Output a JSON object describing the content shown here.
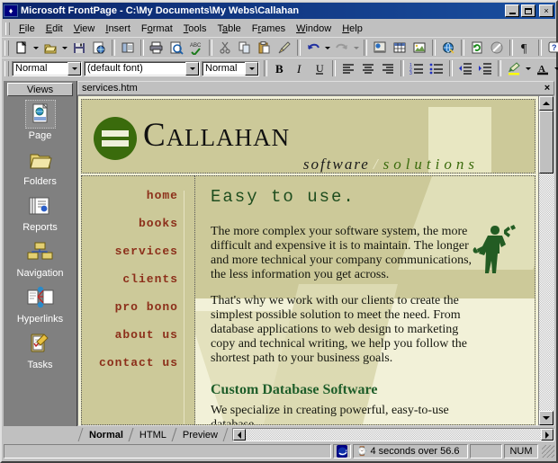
{
  "window": {
    "title": "Microsoft FrontPage - C:\\My Documents\\My Webs\\Callahan",
    "icon": "frontpage-icon",
    "minimize_label": "_",
    "maximize_label": "",
    "close_label": "×"
  },
  "menubar": {
    "items": [
      {
        "label": "File",
        "accel": "F"
      },
      {
        "label": "Edit",
        "accel": "E"
      },
      {
        "label": "View",
        "accel": "V"
      },
      {
        "label": "Insert",
        "accel": "I"
      },
      {
        "label": "Format",
        "accel": "o"
      },
      {
        "label": "Tools",
        "accel": "T"
      },
      {
        "label": "Table",
        "accel": "a"
      },
      {
        "label": "Frames",
        "accel": "r"
      },
      {
        "label": "Window",
        "accel": "W"
      },
      {
        "label": "Help",
        "accel": "H"
      }
    ]
  },
  "standard_toolbar": {
    "buttons": [
      "new-page-icon",
      "new-page-dropdown-icon",
      "open-icon",
      "open-dropdown-icon",
      "save-icon",
      "publish-web-icon",
      "folder-list-icon",
      "print-icon",
      "print-preview-icon",
      "spelling-icon",
      "cut-icon",
      "copy-icon",
      "paste-icon",
      "format-painter-icon",
      "undo-icon",
      "undo-dropdown-icon",
      "redo-icon",
      "redo-dropdown-icon",
      "insert-component-icon",
      "insert-table-icon",
      "insert-picture-icon",
      "hyperlink-icon",
      "refresh-icon",
      "stop-icon",
      "show-all-icon",
      "help-icon",
      "help-dropdown-icon"
    ]
  },
  "formatting_toolbar": {
    "style_combo": {
      "value": "Normal",
      "name": "style-combo"
    },
    "font_combo": {
      "value": "(default font)",
      "name": "font-combo"
    },
    "size_combo": {
      "value": "Normal",
      "name": "font-size-combo"
    },
    "buttons": [
      "bold-icon",
      "italic-icon",
      "underline-icon",
      "align-left-icon",
      "align-center-icon",
      "align-right-icon",
      "numbered-list-icon",
      "bulleted-list-icon",
      "decrease-indent-icon",
      "increase-indent-icon",
      "highlight-color-icon",
      "highlight-dropdown-icon",
      "font-color-icon",
      "font-color-dropdown-icon",
      "toolbar-overflow-icon"
    ]
  },
  "views_bar": {
    "header": "Views",
    "items": [
      {
        "label": "Page",
        "icon": "page-view-icon",
        "selected": true
      },
      {
        "label": "Folders",
        "icon": "folders-view-icon",
        "selected": false
      },
      {
        "label": "Reports",
        "icon": "reports-view-icon",
        "selected": false
      },
      {
        "label": "Navigation",
        "icon": "navigation-view-icon",
        "selected": false
      },
      {
        "label": "Hyperlinks",
        "icon": "hyperlinks-view-icon",
        "selected": false
      },
      {
        "label": "Tasks",
        "icon": "tasks-view-icon",
        "selected": false
      }
    ]
  },
  "document": {
    "tab_label": "services.htm",
    "close_label": "×"
  },
  "webpage": {
    "logo": {
      "mark": "equals-circle-logo",
      "brand_first": "C",
      "brand_rest": "ALLAHAN",
      "tagline_primary": "software",
      "tagline_separator": "/",
      "tagline_secondary": "solutions"
    },
    "nav_links": [
      {
        "label": "home"
      },
      {
        "label": "books"
      },
      {
        "label": "services"
      },
      {
        "label": "clients"
      },
      {
        "label": "pro bono"
      },
      {
        "label": "about us"
      },
      {
        "label": "contact us"
      }
    ],
    "heading": "Easy to use.",
    "paragraphs": [
      "The more complex your software system, the more difficult and expensive it is to maintain. The longer and more technical your company communications, the less information you get across.",
      "That's why we work with our clients to create the simplest possible solution to meet the need. From database applications to web design to marketing copy and technical writing, we help you follow the shortest path to your business goals."
    ],
    "subheading": "Custom Database Software",
    "subheading_paragraph": "We specialize in creating powerful, easy-to-use database",
    "figure_icon": "worker-with-wrench-graphic",
    "colors": {
      "header_bg": "#ccc999",
      "page_bg": "#f2f1d8",
      "logo_green": "#3a6b0c",
      "heading_green": "#1e4d1e",
      "nav_red": "#8c2f1a"
    }
  },
  "view_tabs": [
    {
      "label": "Normal",
      "active": true
    },
    {
      "label": "HTML",
      "active": false
    },
    {
      "label": "Preview",
      "active": false
    }
  ],
  "status_bar": {
    "message": "",
    "browser_icon": "internet-explorer-icon",
    "timing_icon": "hourglass-icon",
    "timing": "4 seconds over 56.6",
    "spacer": "",
    "num_lock": "NUM"
  }
}
